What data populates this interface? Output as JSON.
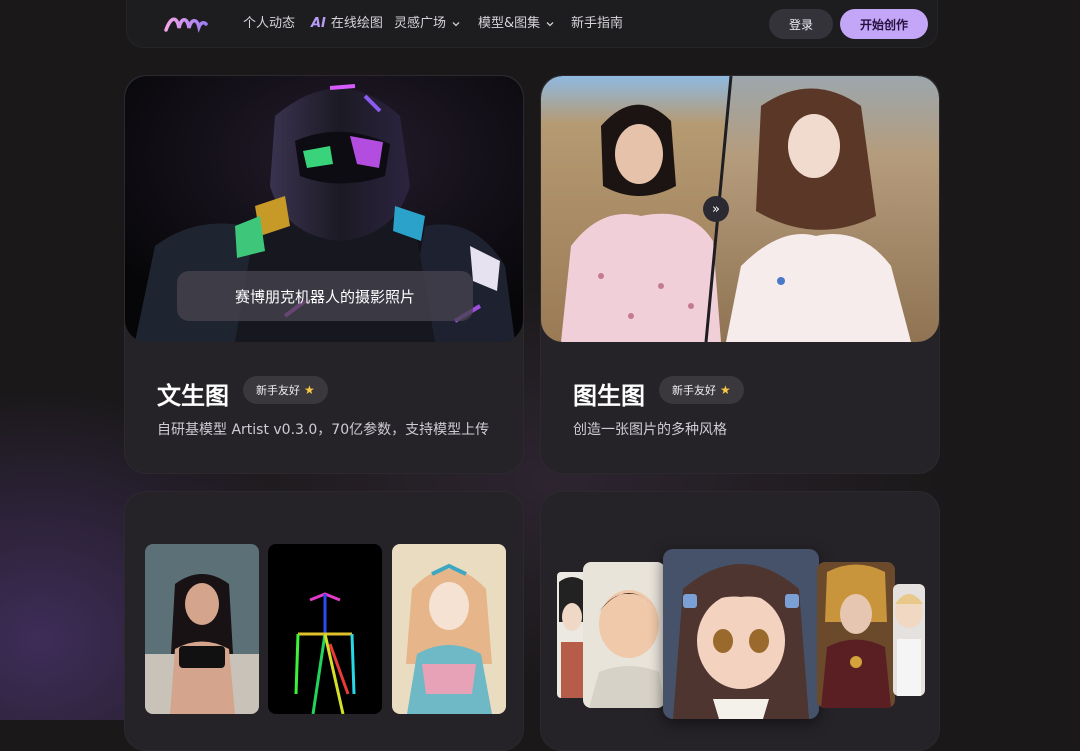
{
  "nav": {
    "items": [
      {
        "label": "个人动态"
      },
      {
        "prefix": "AI",
        "label": "在线绘图"
      },
      {
        "label": "灵感广场"
      },
      {
        "label": "模型&图集"
      },
      {
        "label": "新手指南"
      }
    ],
    "login_label": "登录",
    "start_label": "开始创作"
  },
  "cards": {
    "text2img": {
      "caption": "赛博朋克机器人的摄影照片",
      "title": "文生图",
      "badge": "新手友好",
      "desc": "自研基模型 Artist v0.3.0，70亿参数，支持模型上传"
    },
    "img2img": {
      "swap_icon": "»",
      "title": "图生图",
      "badge": "新手友好",
      "desc": "创造一张图片的多种风格"
    }
  },
  "colors": {
    "background": "#1a1819",
    "card": "#252328",
    "accent": "#c3a6f7",
    "star": "#f7c843"
  }
}
